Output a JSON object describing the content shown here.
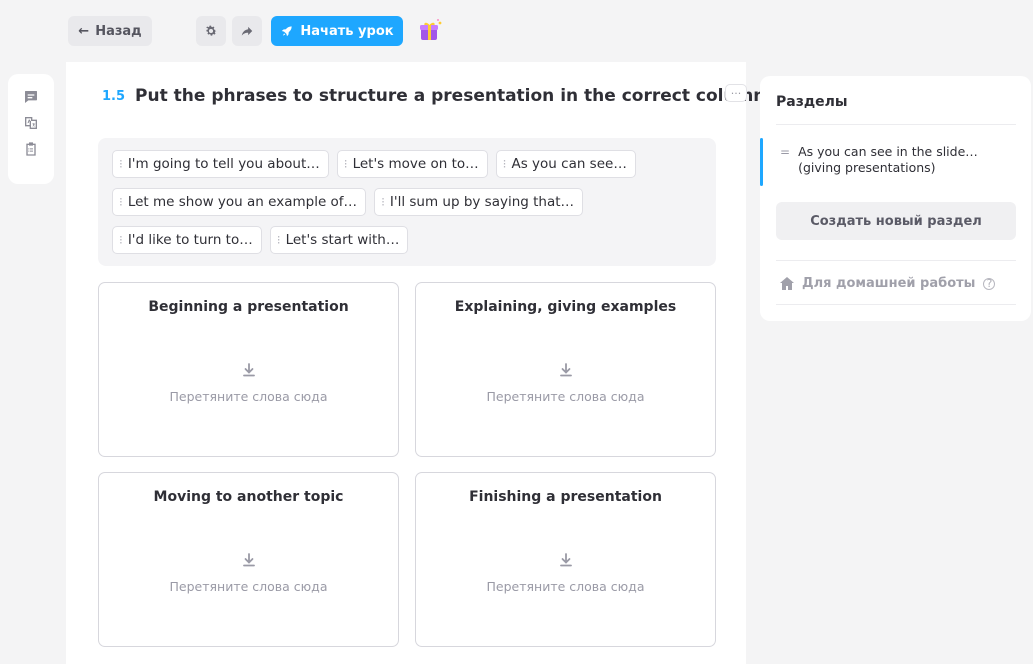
{
  "toolbar": {
    "back_label": "Назад",
    "start_label": "Начать урок"
  },
  "task": {
    "number": "1.5",
    "title": "Put the phrases to structure a presentation in the correct column.",
    "more": "···"
  },
  "chips": [
    [
      "I'm going to tell you about…",
      "Let's move on to…",
      "As you can see…"
    ],
    [
      "Let me show you an example of…",
      "I'll sum up by saying that…"
    ],
    [
      "I'd like to turn to…",
      "Let's start with…"
    ]
  ],
  "columns": [
    {
      "title": "Beginning a presentation",
      "hint": "Перетяните слова сюда"
    },
    {
      "title": "Explaining, giving examples",
      "hint": "Перетяните слова сюда"
    },
    {
      "title": "Moving to another topic",
      "hint": "Перетяните слова сюда"
    },
    {
      "title": "Finishing a presentation",
      "hint": "Перетяните слова сюда"
    }
  ],
  "sections": {
    "title": "Разделы",
    "item_label": "As you can see in the slide… (giving presentations)",
    "create_label": "Создать новый раздел",
    "homework_label": "Для домашней работы"
  },
  "colors": {
    "accent": "#1ea7ff"
  }
}
